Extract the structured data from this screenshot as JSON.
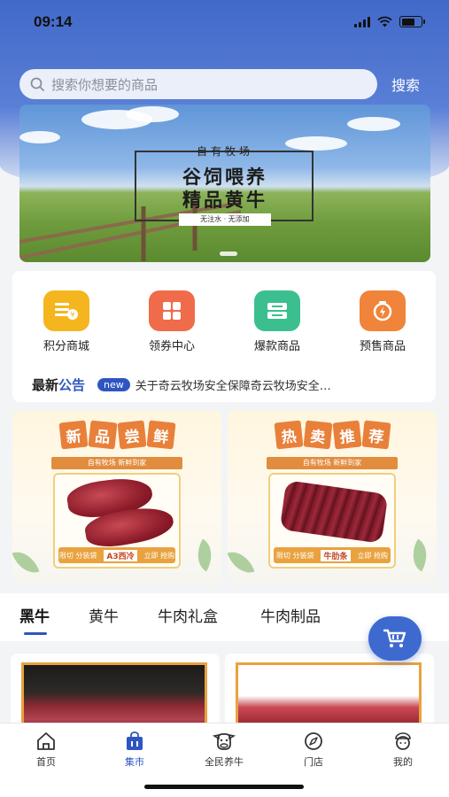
{
  "status_bar": {
    "time": "09:14"
  },
  "search": {
    "placeholder": "搜索你想要的商品",
    "button": "搜索"
  },
  "banner": {
    "small_title": "自有牧场",
    "line1": "谷饲喂养",
    "line2": "精品黄牛",
    "tag": "无注水 · 无添加"
  },
  "menu": [
    {
      "label": "积分商城",
      "icon": "points-mall-icon",
      "color": "#f5b51e"
    },
    {
      "label": "领券中心",
      "icon": "coupon-grid-icon",
      "color": "#ef6b4a"
    },
    {
      "label": "爆款商品",
      "icon": "hot-product-icon",
      "color": "#3bbf8f"
    },
    {
      "label": "预售商品",
      "icon": "presale-icon",
      "color": "#f0843a"
    }
  ],
  "notice": {
    "label_dark": "最新",
    "label_blue": "公告",
    "badge": "new",
    "text": "关于奇云牧场安全保障奇云牧场安全…"
  },
  "promos": [
    {
      "title_chars": [
        "新",
        "品",
        "尝",
        "鲜"
      ],
      "subtitle": "自有牧场 新鲜到家",
      "foot_left": "限切 分装袋",
      "foot_mid": "A3西冷",
      "foot_right": "立即 抢购"
    },
    {
      "title_chars": [
        "热",
        "卖",
        "推",
        "荐"
      ],
      "subtitle": "自有牧场 新鲜到家",
      "foot_left": "限切 分装袋",
      "foot_mid": "牛肋条",
      "foot_right": "立即 抢购"
    }
  ],
  "tabs": [
    "黑牛",
    "黄牛",
    "牛肉礼盒",
    "牛肉制品"
  ],
  "active_tab": "黑牛",
  "bottom_nav": [
    {
      "label": "首页",
      "icon": "home-icon"
    },
    {
      "label": "集市",
      "icon": "market-bag-icon",
      "active": true
    },
    {
      "label": "全民养牛",
      "icon": "cow-face-icon"
    },
    {
      "label": "门店",
      "icon": "compass-icon"
    },
    {
      "label": "我的",
      "icon": "user-profile-icon"
    }
  ],
  "colors": {
    "primary": "#2f56c0",
    "accent_orange": "#e8803a"
  }
}
